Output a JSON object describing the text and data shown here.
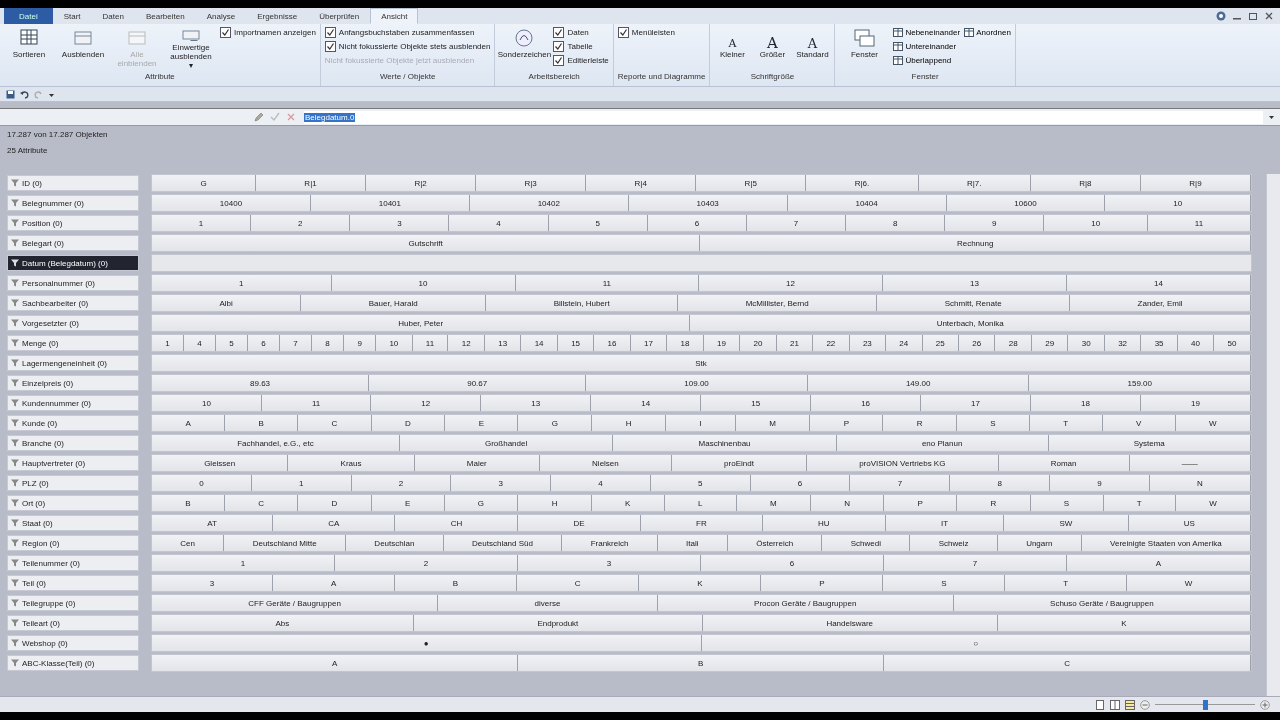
{
  "tabs": [
    {
      "label": "Datei",
      "kind": "file",
      "selected": false
    },
    {
      "label": "Start",
      "kind": "tab",
      "selected": false
    },
    {
      "label": "Daten",
      "kind": "tab",
      "selected": false
    },
    {
      "label": "Bearbeiten",
      "kind": "tab",
      "selected": false
    },
    {
      "label": "Analyse",
      "kind": "tab",
      "selected": false
    },
    {
      "label": "Ergebnisse",
      "kind": "tab",
      "selected": false
    },
    {
      "label": "Überprüfen",
      "kind": "tab",
      "selected": false
    },
    {
      "label": "Ansicht",
      "kind": "tab",
      "selected": true
    }
  ],
  "ribbon": {
    "groups": [
      {
        "title": "Attribute",
        "items": [
          {
            "kind": "big",
            "label": "Sortieren",
            "disabled": false
          },
          {
            "kind": "big",
            "label": "Ausblenden",
            "disabled": false
          },
          {
            "kind": "big",
            "label": "Alle einblenden",
            "disabled": true
          },
          {
            "kind": "big",
            "label": "Einwertige ausblenden ▾",
            "disabled": false
          },
          {
            "kind": "check",
            "label": "Importnamen anzeigen",
            "checked": true
          }
        ]
      },
      {
        "title": "Werte / Objekte",
        "items": [
          {
            "kind": "check",
            "label": "Anfangsbuchstaben zusammenfassen",
            "checked": true
          },
          {
            "kind": "check",
            "label": "Nicht fokussierte Objekte stets ausblenden",
            "checked": true
          },
          {
            "kind": "text",
            "label": "Nicht fokussierte Objekte jetzt ausblenden",
            "disabled": true
          }
        ]
      },
      {
        "title": "Arbeitsbereich",
        "items": [
          {
            "kind": "big",
            "label": "Sonderzeichen",
            "disabled": false
          },
          {
            "kind": "check",
            "label": "Daten",
            "checked": true
          },
          {
            "kind": "check",
            "label": "Tabelle",
            "checked": true
          },
          {
            "kind": "check",
            "label": "Editierleiste",
            "checked": true
          }
        ]
      },
      {
        "title": "Reporte und Diagramme",
        "items": [
          {
            "kind": "check",
            "label": "Menüleisten",
            "checked": true
          }
        ]
      },
      {
        "title": "Schriftgröße",
        "items": [
          {
            "kind": "font",
            "glyph": "A",
            "label": "Kleiner"
          },
          {
            "kind": "font",
            "glyph": "A",
            "label": "Größer"
          },
          {
            "kind": "font",
            "glyph": "A",
            "label": "Standard"
          }
        ]
      },
      {
        "title": "Fenster",
        "items": [
          {
            "kind": "big",
            "label": "Fenster",
            "disabled": false
          },
          {
            "kind": "small",
            "label": "Nebeneinander"
          },
          {
            "kind": "small",
            "label": "Untereinander"
          },
          {
            "kind": "small",
            "label": "Überlappend"
          },
          {
            "kind": "small",
            "label": "Anordnen"
          }
        ]
      }
    ]
  },
  "formula_bar": {
    "value": "Belegdatum.0"
  },
  "info": {
    "objects": "17.287 von 17.287 Objekten",
    "attributes": "25 Attribute"
  },
  "attributes": [
    {
      "label": "ID (0)",
      "selected": false,
      "values": [
        "G",
        "R|1",
        "R|2",
        "R|3",
        "R|4",
        "R|5",
        "R|6.",
        "R|7.",
        "R|8",
        "R|9"
      ]
    },
    {
      "label": "Belegnummer (0)",
      "selected": false,
      "values": [
        "10400",
        "10401",
        "10402",
        "10403",
        "10404",
        "10600",
        "10"
      ]
    },
    {
      "label": "Position (0)",
      "selected": false,
      "values": [
        "1",
        "2",
        "3",
        "4",
        "5",
        "6",
        "7",
        "8",
        "9",
        "10",
        "11"
      ]
    },
    {
      "label": "Belegart (0)",
      "selected": false,
      "values": [
        "Gutschrift",
        "Rechnung"
      ]
    },
    {
      "label": "Datum (Belegdatum) (0)",
      "selected": true
    },
    {
      "label": "Personalnummer (0)",
      "selected": false,
      "values": [
        "1",
        "10",
        "11",
        "12",
        "13",
        "14"
      ]
    },
    {
      "label": "Sachbearbeiter (0)",
      "selected": false,
      "values": [
        "Albi",
        "Bauer, Harald",
        "Billstein, Hubert",
        "McMillister, Bernd",
        "Schmitt, Renate",
        "Zander, Emil"
      ]
    },
    {
      "label": "Vorgesetzter (0)",
      "selected": false,
      "values": [
        "Huber, Peter",
        "Unterbach, Monika"
      ]
    },
    {
      "label": "Menge (0)",
      "selected": false,
      "values": [
        "1",
        "4",
        "5",
        "6",
        "7",
        "8",
        "9",
        "10",
        "11",
        "12",
        "13",
        "14",
        "15",
        "16",
        "17",
        "18",
        "19",
        "20",
        "21",
        "22",
        "23",
        "24",
        "25",
        "26",
        "28",
        "29",
        "30",
        "32",
        "35",
        "40",
        "50"
      ]
    },
    {
      "label": "Lagermengeneinheit (0)",
      "selected": false,
      "values": [
        "Stk"
      ]
    },
    {
      "label": "Einzelpreis (0)",
      "selected": false,
      "values": [
        "89.63",
        "90.67",
        "109.00",
        "149.00",
        "159.00"
      ]
    },
    {
      "label": "Kundennummer (0)",
      "selected": false,
      "values": [
        "10",
        "11",
        "12",
        "13",
        "14",
        "15",
        "16",
        "17",
        "18",
        "19"
      ]
    },
    {
      "label": "Kunde (0)",
      "selected": false,
      "values": [
        "A",
        "B",
        "C",
        "D",
        "E",
        "G",
        "H",
        "I",
        "M",
        "P",
        "R",
        "S",
        "T",
        "V",
        "W"
      ]
    },
    {
      "label": "Branche (0)",
      "selected": false,
      "values": [
        "Fachhandel, e.G., etc",
        "Großhandel",
        "Maschinenbau",
        "eno Planun",
        "Systema"
      ]
    },
    {
      "label": "Hauptvertreter (0)",
      "selected": false,
      "values": [
        "Gleissen",
        "Kraus",
        "Maier",
        "Nielsen",
        "proEindt",
        "proVISION Vertriebs KG",
        "Roman",
        "——"
      ]
    },
    {
      "label": "PLZ (0)",
      "selected": false,
      "values": [
        "0",
        "1",
        "2",
        "3",
        "4",
        "5",
        "6",
        "7",
        "8",
        "9",
        "N"
      ]
    },
    {
      "label": "Ort (0)",
      "selected": false,
      "values": [
        "B",
        "C",
        "D",
        "E",
        "G",
        "H",
        "K",
        "L",
        "M",
        "N",
        "P",
        "R",
        "S",
        "T",
        "W"
      ]
    },
    {
      "label": "Staat (0)",
      "selected": false,
      "values": [
        "AT",
        "CA",
        "CH",
        "DE",
        "FR",
        "HU",
        "IT",
        "SW",
        "US"
      ]
    },
    {
      "label": "Region (0)",
      "selected": false,
      "values": [
        "Cen",
        "Deutschland Mitte",
        "Deutschlan",
        "Deutschland Süd",
        "Frankreich",
        "Itali",
        "Österreich",
        "Schwedi",
        "Schweiz",
        "Ungarn",
        "Vereinigte Staaten von Amerika"
      ]
    },
    {
      "label": "Teilenummer (0)",
      "selected": false,
      "values": [
        "1",
        "2",
        "3",
        "6",
        "7",
        "A"
      ]
    },
    {
      "label": "Teil (0)",
      "selected": false,
      "values": [
        "3",
        "A",
        "B",
        "C",
        "K",
        "P",
        "S",
        "T",
        "W"
      ]
    },
    {
      "label": "Teilegruppe (0)",
      "selected": false,
      "values": [
        "CFF Geräte / Baugruppen",
        "diverse",
        "Procon Geräte / Baugruppen",
        "Schuso Geräte / Baugruppen"
      ]
    },
    {
      "label": "Teileart (0)",
      "selected": false,
      "values": [
        "Abs",
        "Endprodukt",
        "Handelsware",
        "K"
      ]
    },
    {
      "label": "Webshop (0)",
      "selected": false,
      "values": [
        "●",
        "○"
      ]
    },
    {
      "label": "ABC-Klasse(Teil) (0)",
      "selected": false,
      "values": [
        "A",
        "B",
        "C"
      ]
    }
  ],
  "status_bar": {
    "zoom": {
      "level": 0.5
    }
  }
}
